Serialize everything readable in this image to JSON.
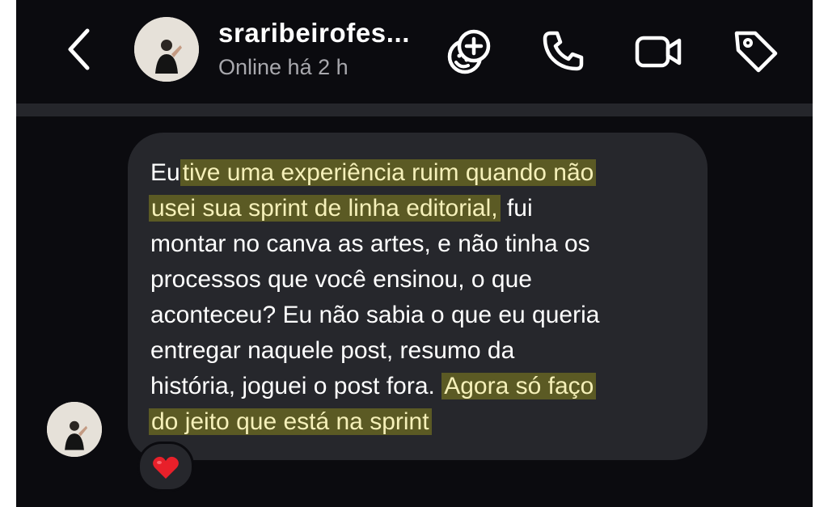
{
  "header": {
    "username": "sraribeirofes...",
    "status": "Online há 2 h"
  },
  "icons": {
    "back": "chevron-left-icon",
    "avatar": "avatar",
    "sticker": "sticker-smiley-add-icon",
    "phone": "phone-icon",
    "video": "video-camera-icon",
    "tag": "tag-icon",
    "reaction": "heart-icon"
  },
  "message": {
    "line1": {
      "plain": "Eu",
      "highlight": "tive uma experiência ruim quando não"
    },
    "line2": {
      "highlight": "usei sua sprint de linha editorial,",
      "plain": " fui"
    },
    "line3": "montar no canva as artes, e não tinha os",
    "line4": "processos que você ensinou, o que",
    "line5": "aconteceu? Eu não sabia o que eu queria",
    "line6": "entregar naquele post, resumo da",
    "line7": {
      "plain": "história, joguei o post fora.",
      "highlight": "Agora só faço"
    },
    "line8": {
      "highlight": "do jeito que está na sprint"
    }
  },
  "colors": {
    "background": "#0b0b0f",
    "bubble": "#26272c",
    "highlight": "#5b5a24",
    "highlight_text": "#f5f0b9",
    "reaction": "#e8202a"
  }
}
